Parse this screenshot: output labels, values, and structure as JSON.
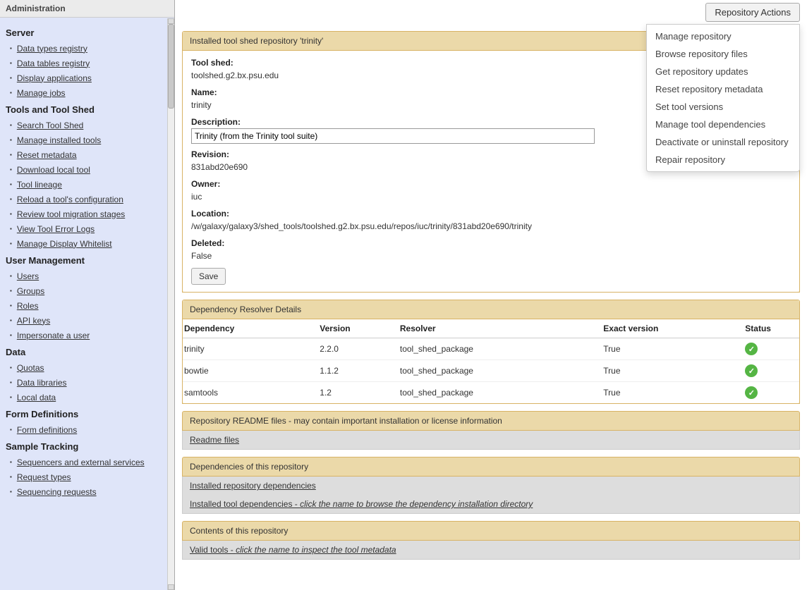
{
  "sidebar": {
    "title": "Administration",
    "groups": [
      {
        "heading": "Server",
        "items": [
          "Data types registry",
          "Data tables registry",
          "Display applications",
          "Manage jobs"
        ]
      },
      {
        "heading": "Tools and Tool Shed",
        "items": [
          "Search Tool Shed",
          "Manage installed tools",
          "Reset metadata",
          "Download local tool",
          "Tool lineage",
          "Reload a tool's configuration",
          "Review tool migration stages",
          "View Tool Error Logs",
          "Manage Display Whitelist"
        ]
      },
      {
        "heading": "User Management",
        "items": [
          "Users",
          "Groups",
          "Roles",
          "API keys",
          "Impersonate a user"
        ]
      },
      {
        "heading": "Data",
        "items": [
          "Quotas",
          "Data libraries",
          "Local data"
        ]
      },
      {
        "heading": "Form Definitions",
        "items": [
          "Form definitions"
        ]
      },
      {
        "heading": "Sample Tracking",
        "items": [
          "Sequencers and external services",
          "Request types",
          "Sequencing requests"
        ]
      }
    ]
  },
  "menu": {
    "button": "Repository Actions",
    "items": [
      "Manage repository",
      "Browse repository files",
      "Get repository updates",
      "Reset repository metadata",
      "Set tool versions",
      "Manage tool dependencies",
      "Deactivate or uninstall repository",
      "Repair repository"
    ]
  },
  "repo": {
    "panel_title": "Installed tool shed repository 'trinity'",
    "labels": {
      "tool_shed": "Tool shed:",
      "name": "Name:",
      "description": "Description:",
      "revision": "Revision:",
      "owner": "Owner:",
      "location": "Location:",
      "deleted": "Deleted:"
    },
    "tool_shed": "toolshed.g2.bx.psu.edu",
    "name": "trinity",
    "description": "Trinity (from the Trinity tool suite)",
    "revision": "831abd20e690",
    "owner": "iuc",
    "location": "/w/galaxy/galaxy3/shed_tools/toolshed.g2.bx.psu.edu/repos/iuc/trinity/831abd20e690/trinity",
    "deleted": "False",
    "save": "Save"
  },
  "deps": {
    "panel_title": "Dependency Resolver Details",
    "cols": {
      "dep": "Dependency",
      "ver": "Version",
      "res": "Resolver",
      "exact": "Exact version",
      "status": "Status"
    },
    "rows": [
      {
        "dep": "trinity",
        "ver": "2.2.0",
        "res": "tool_shed_package",
        "exact": "True",
        "status": "ok"
      },
      {
        "dep": "bowtie",
        "ver": "1.1.2",
        "res": "tool_shed_package",
        "exact": "True",
        "status": "ok"
      },
      {
        "dep": "samtools",
        "ver": "1.2",
        "res": "tool_shed_package",
        "exact": "True",
        "status": "ok"
      }
    ]
  },
  "readme": {
    "panel": "Repository README files - may contain important installation or license information",
    "row": "Readme files"
  },
  "depsOf": {
    "panel": "Dependencies of this repository",
    "row1": "Installed repository dependencies",
    "row2": "Installed tool dependencies - ",
    "row2ital": "click the name to browse the dependency installation directory"
  },
  "contents": {
    "panel": "Contents of this repository",
    "row": "Valid tools - ",
    "rowital": "click the name to inspect the tool metadata"
  }
}
